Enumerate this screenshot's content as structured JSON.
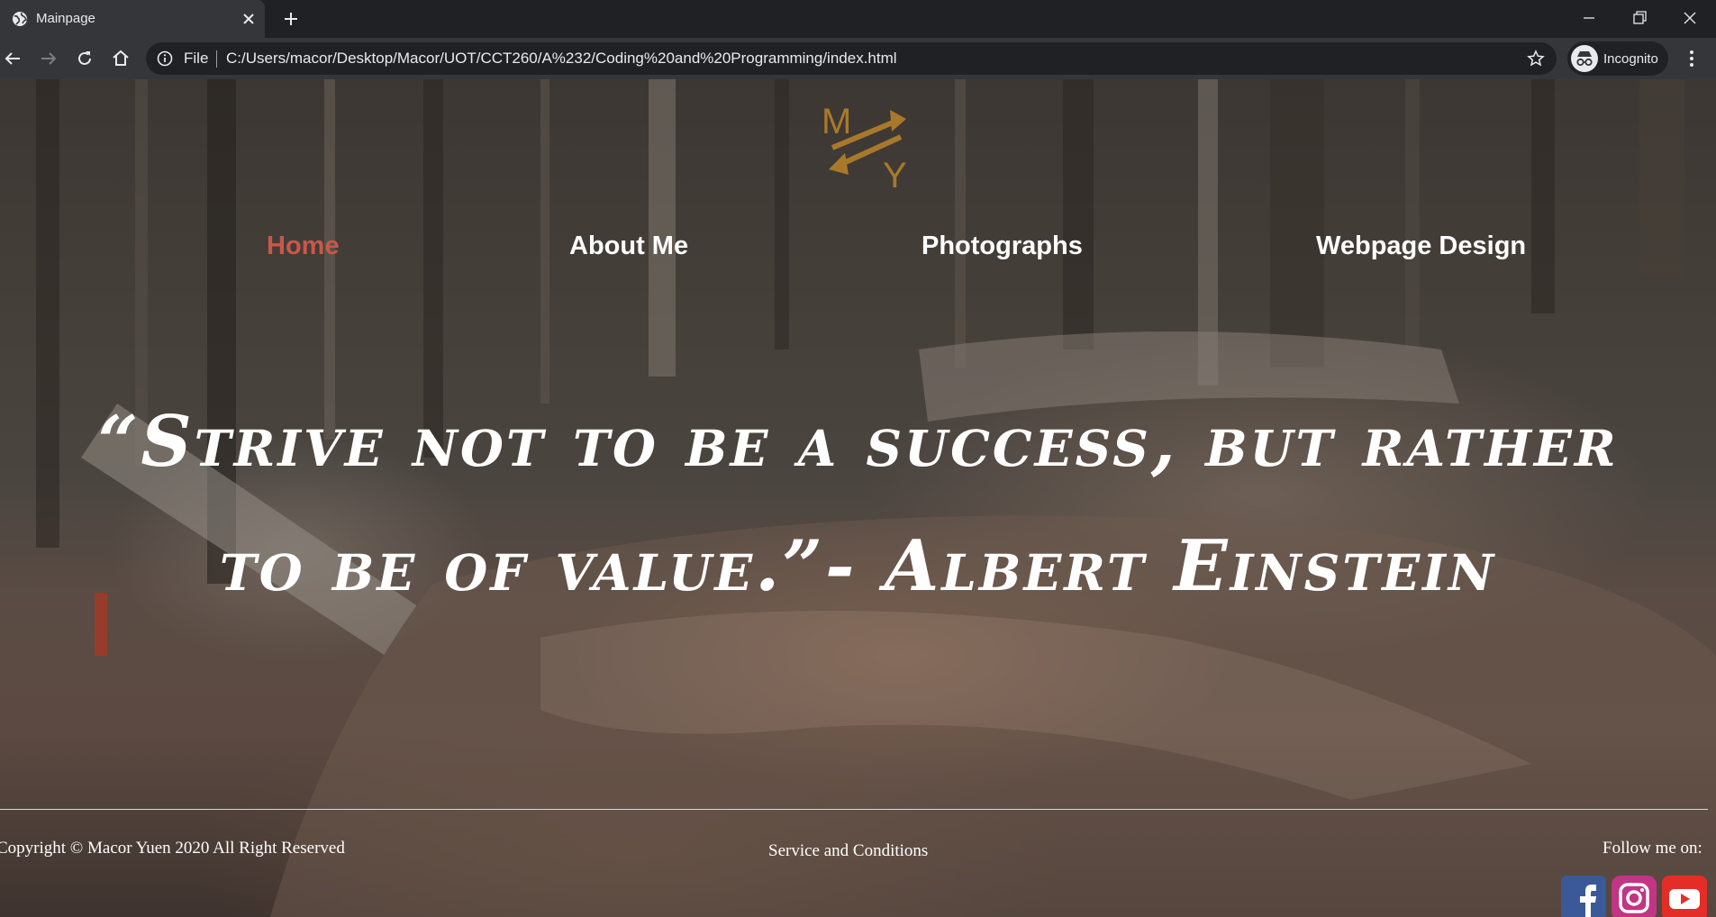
{
  "browser": {
    "tab_title": "Mainpage",
    "scheme_label": "File",
    "url": "C:/Users/macor/Desktop/Macor/UOT/CCT260/A%232/Coding%20and%20Programming/index.html",
    "profile_label": "Incognito"
  },
  "logo": {
    "letter_top": "M",
    "letter_bottom": "Y",
    "color": "#a8792a"
  },
  "nav": {
    "items": [
      {
        "label": "Home",
        "active": true
      },
      {
        "label": "About Me",
        "active": false
      },
      {
        "label": "Photographs",
        "active": false
      },
      {
        "label": "Webpage Design",
        "active": false
      }
    ],
    "active_color": "#c8584a"
  },
  "quote": {
    "line1": "“Strive not to be a success, but rather",
    "line2": "to be of value.”- Albert Einstein"
  },
  "footer": {
    "copyright": "Copyright © Macor Yuen 2020 All Right Reserved",
    "service": "Service and Conditions",
    "follow": "Follow me on:",
    "social": [
      {
        "name": "facebook-icon",
        "color": "#3b5998"
      },
      {
        "name": "instagram-icon",
        "color": "#c13584"
      },
      {
        "name": "youtube-icon",
        "color": "#e52d27"
      }
    ]
  }
}
